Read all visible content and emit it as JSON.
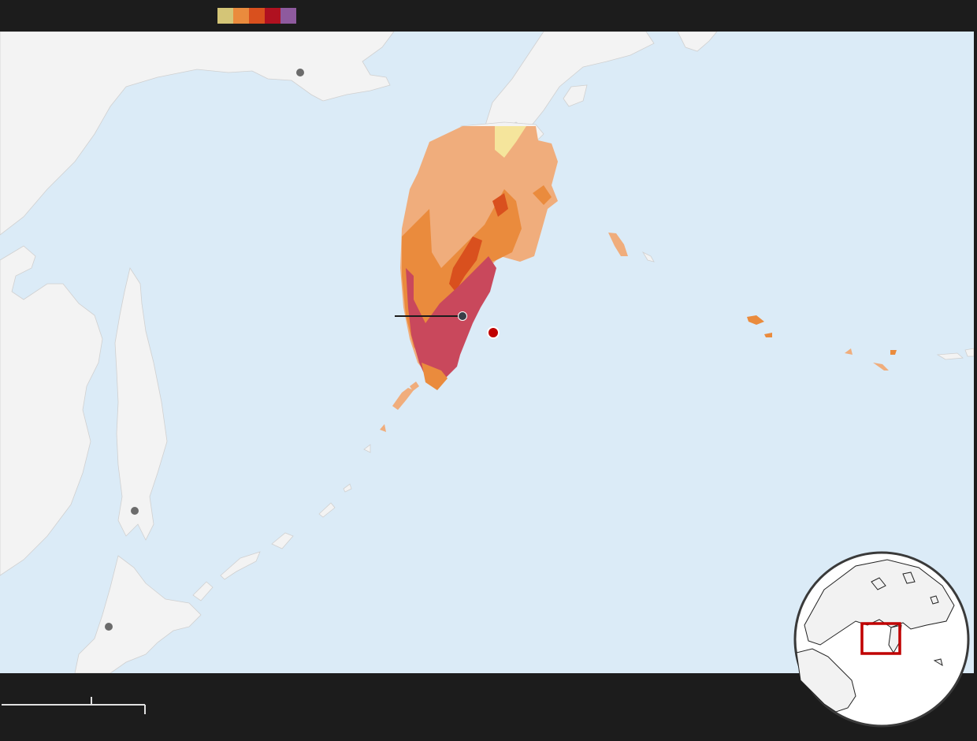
{
  "legend": {
    "swatches": [
      {
        "name": "level-1",
        "color": "#d4c577"
      },
      {
        "name": "level-2",
        "color": "#ea8b3d"
      },
      {
        "name": "level-3",
        "color": "#d9501e"
      },
      {
        "name": "level-4",
        "color": "#b01120"
      },
      {
        "name": "level-5",
        "color": "#8e5a9e"
      }
    ]
  },
  "colors": {
    "sea": "#dbebf7",
    "land": "#f3f3f3",
    "land_edge": "#d0d0d0",
    "shake_light": "#f0ad7c",
    "shake_moderate": "#ea8b3d",
    "shake_strong": "#d9501e",
    "shake_severe": "#c9485c",
    "shake_weak": "#f5e59c",
    "city_marker": "#6b6b6b",
    "epicenter": "#c00000",
    "inset_box": "#c00000"
  },
  "map": {
    "epicenter_marker": "red-dot",
    "city_markers": [
      "city-1",
      "city-2",
      "city-3",
      "city-4"
    ]
  }
}
